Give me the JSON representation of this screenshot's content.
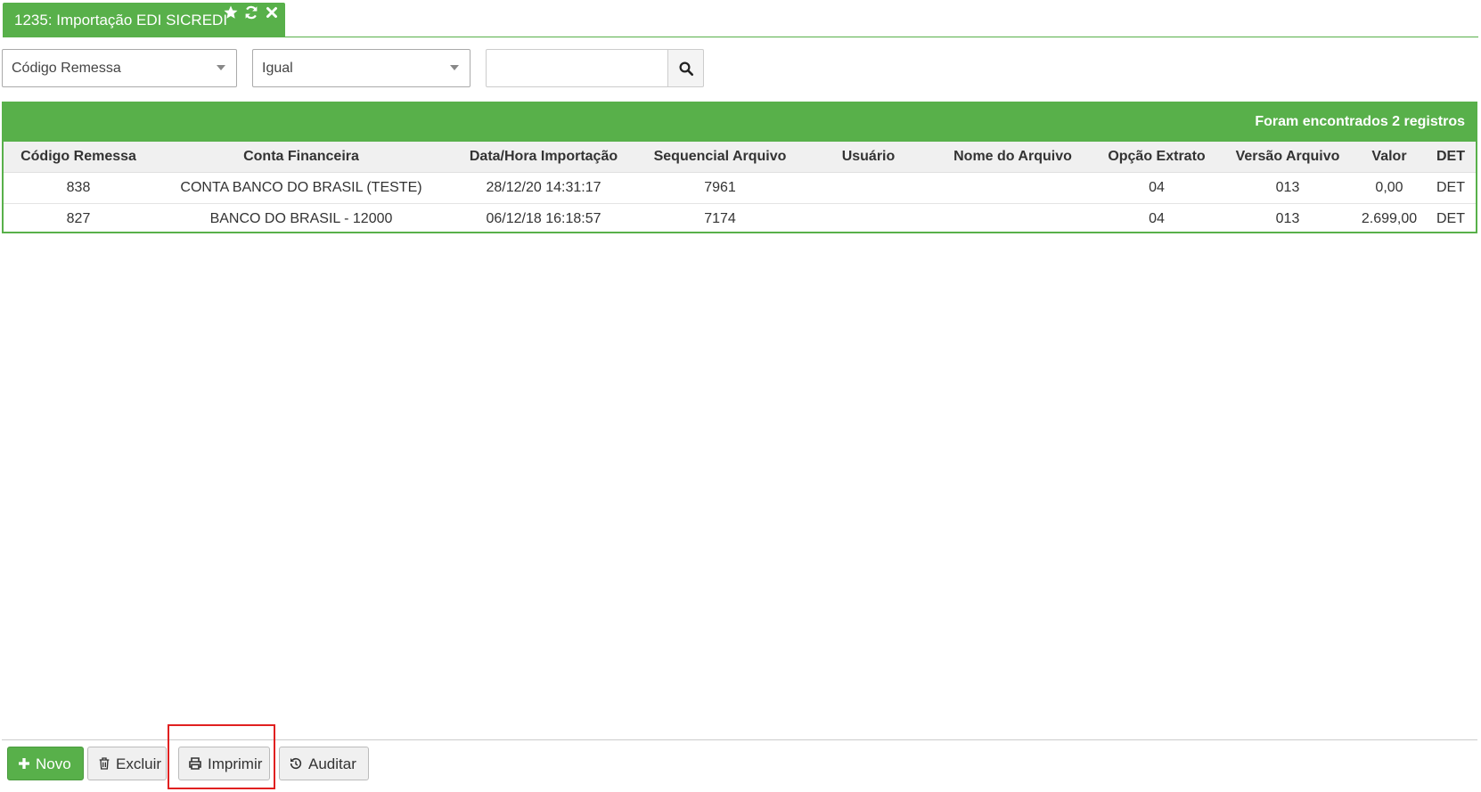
{
  "tab": {
    "title": "1235: Importação EDI SICREDI",
    "icons": [
      "star-icon",
      "refresh-icon",
      "close-icon"
    ]
  },
  "filters": {
    "field_select": "Código Remessa",
    "operator_select": "Igual",
    "search_value": ""
  },
  "table": {
    "records_text": "Foram encontrados 2 registros",
    "columns": [
      "Código Remessa",
      "Conta Financeira",
      "Data/Hora Importação",
      "Sequencial Arquivo",
      "Usuário",
      "Nome do Arquivo",
      "Opção Extrato",
      "Versão Arquivo",
      "Valor",
      "DET"
    ],
    "rows": [
      [
        "838",
        "CONTA BANCO DO BRASIL (TESTE)",
        "28/12/20 14:31:17",
        "7961",
        "",
        "",
        "04",
        "013",
        "0,00",
        "DET"
      ],
      [
        "827",
        "BANCO DO BRASIL - 12000",
        "06/12/18 16:18:57",
        "7174",
        "",
        "",
        "04",
        "013",
        "2.699,00",
        "DET"
      ]
    ]
  },
  "footer": {
    "novo_label": "Novo",
    "excluir_label": "Excluir",
    "imprimir_label": "Imprimir",
    "auditar_label": "Auditar"
  },
  "colors": {
    "brand_green": "#58b04a",
    "highlight_red": "#e02020"
  }
}
